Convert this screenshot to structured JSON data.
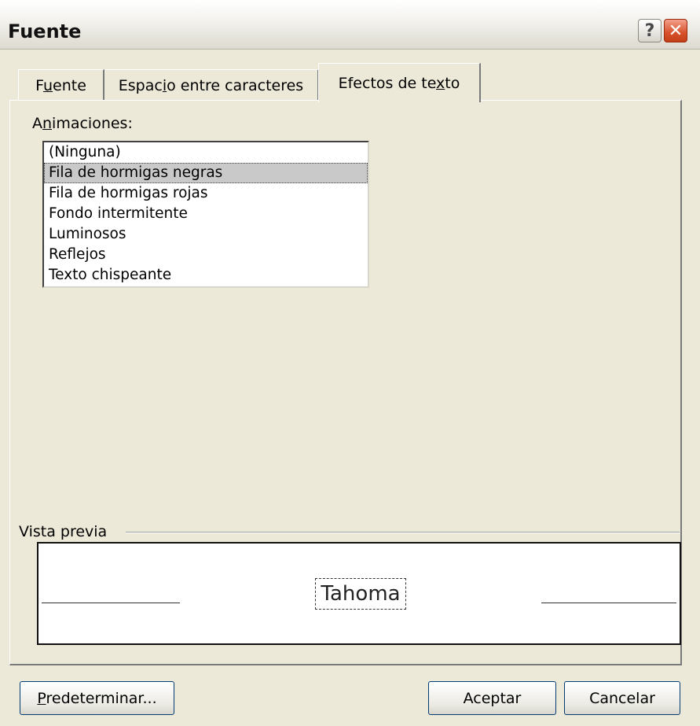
{
  "window": {
    "title": "Fuente"
  },
  "titlebar_buttons": {
    "help_label": "?",
    "close_label": "✕"
  },
  "tabs": [
    {
      "label": "Fuente",
      "active": false
    },
    {
      "label": "Espacio entre caracteres",
      "active": false
    },
    {
      "label": "Efectos de texto",
      "active": true
    }
  ],
  "animations": {
    "label": "Animaciones:",
    "items": [
      "(Ninguna)",
      "Fila de hormigas negras",
      "Fila de hormigas rojas",
      "Fondo intermitente",
      "Luminosos",
      "Reflejos",
      "Texto chispeante"
    ],
    "selected": "Fila de hormigas negras"
  },
  "preview": {
    "label": "Vista previa",
    "sample_text": "Tahoma"
  },
  "buttons": {
    "default": "Predeterminar...",
    "ok": "Aceptar",
    "cancel": "Cancelar"
  }
}
